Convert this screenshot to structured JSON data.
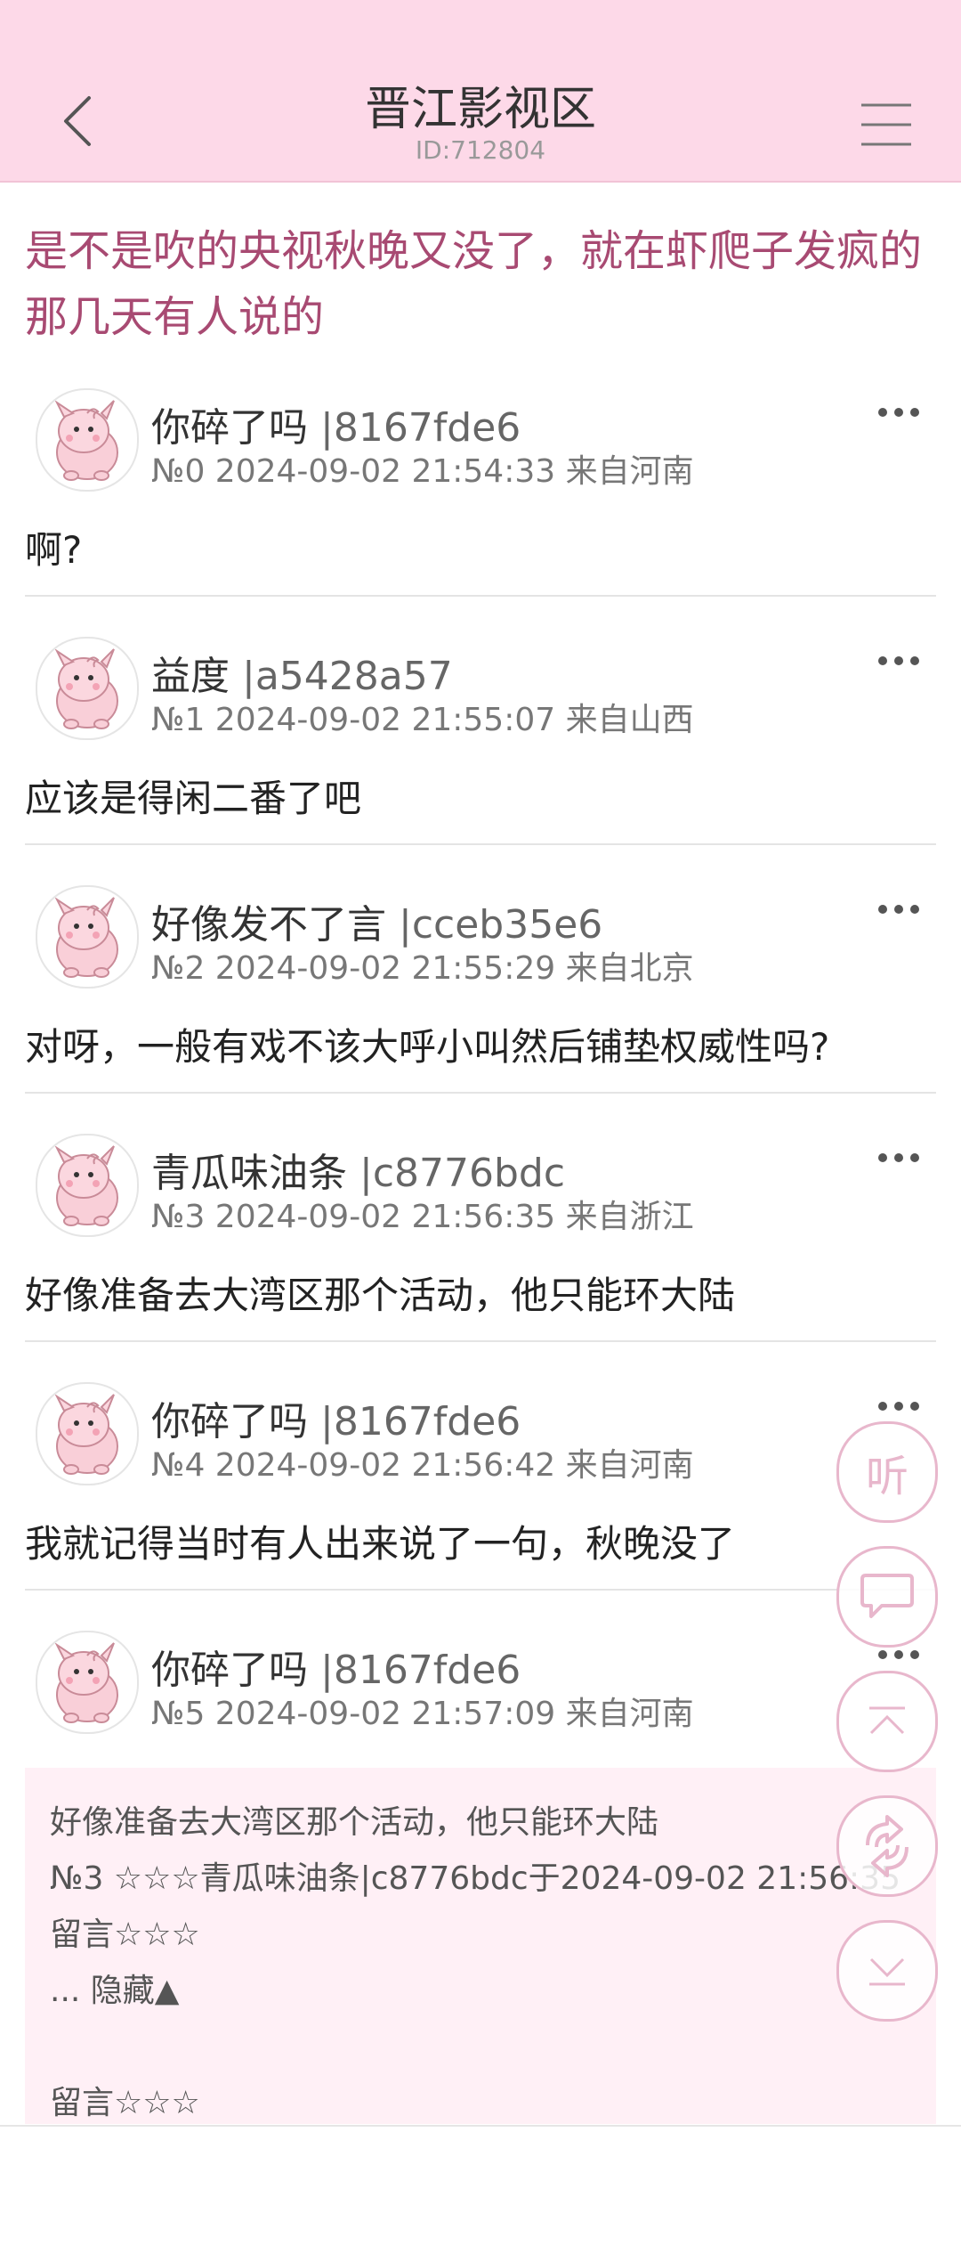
{
  "header": {
    "title": "晋江影视区",
    "id_label": "ID:712804"
  },
  "thread": {
    "title": "是不是吹的央视秋晚又没了，就在虾爬子发疯的那几天有人说的"
  },
  "posts": [
    {
      "name": "你碎了吗",
      "uid": "|8167fde6",
      "meta": "№0 2024-09-02 21:54:33 来自河南",
      "body": "啊?"
    },
    {
      "name": "益度",
      "uid": "|a5428a57",
      "meta": "№1 2024-09-02 21:55:07 来自山西",
      "body": "应该是得闲二番了吧"
    },
    {
      "name": "好像发不了言",
      "uid": "|cceb35e6",
      "meta": "№2 2024-09-02 21:55:29 来自北京",
      "body": "对呀，一般有戏不该大呼小叫然后铺垫权威性吗?"
    },
    {
      "name": "青瓜味油条",
      "uid": "|c8776bdc",
      "meta": "№3 2024-09-02 21:56:35 来自浙江",
      "body": "好像准备去大湾区那个活动，他只能环大陆"
    },
    {
      "name": "你碎了吗",
      "uid": "|8167fde6",
      "meta": "№4 2024-09-02 21:56:42 来自河南",
      "body": "我就记得当时有人出来说了一句，秋晚没了"
    },
    {
      "name": "你碎了吗",
      "uid": "|8167fde6",
      "meta": "№5 2024-09-02 21:57:09 来自河南",
      "body": ""
    }
  ],
  "quote": {
    "line1": "好像准备去大湾区那个活动，他只能环大陆",
    "line2": "№3 ☆☆☆青瓜味油条|c8776bdc于2024-09-02 21:56:35",
    "line3": "留言☆☆☆",
    "line4": "... 隐藏▲",
    "line5": "留言☆☆☆"
  },
  "float_buttons": {
    "listen_label": "听"
  },
  "colors": {
    "header_bg": "#fdd9e8",
    "title_color": "#a84a72",
    "quote_bg": "#fff0f6",
    "float_border": "#e8b7cc"
  },
  "icons": {
    "back": "back-chevron-icon",
    "menu": "menu-icon",
    "more": "more-dots-icon",
    "comment": "comment-icon",
    "top": "scroll-top-icon",
    "refresh": "refresh-icon",
    "bottom": "scroll-bottom-icon",
    "avatar": "clefairy-avatar"
  }
}
